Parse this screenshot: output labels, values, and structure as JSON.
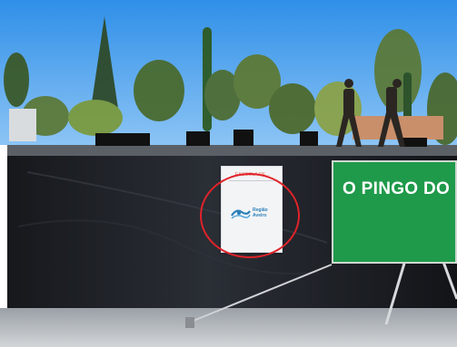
{
  "scene": {
    "colors": {
      "sky": "#3d9cf0",
      "sky_light": "#8cc4f5",
      "stage_fabric": "#1c1f24",
      "banner_green": "#1f9a4a",
      "highlight_red": "#e0232a",
      "pavement": "#c5c8cc"
    }
  },
  "sign": {
    "header": "EASCOLA DE...",
    "brand": "Região Aveiro"
  },
  "banner": {
    "text": "O PINGO DO"
  }
}
